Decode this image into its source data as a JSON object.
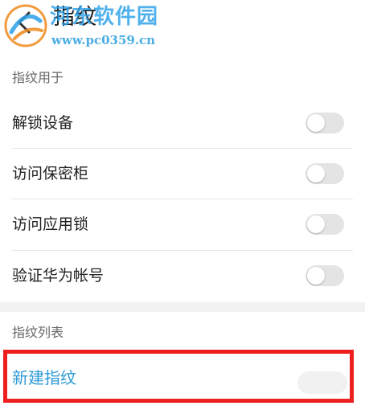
{
  "header": {
    "title": "指纹"
  },
  "watermark": {
    "site_name": "河东软件园",
    "url": "www.pc0359.cn"
  },
  "sections": {
    "usage_header": "指纹用于",
    "list_header": "指纹列表"
  },
  "settings": [
    {
      "label": "解锁设备",
      "enabled": false
    },
    {
      "label": "访问保密柜",
      "enabled": false
    },
    {
      "label": "访问应用锁",
      "enabled": false
    },
    {
      "label": "验证华为帐号",
      "enabled": false
    }
  ],
  "new_fingerprint": {
    "label": "新建指纹"
  },
  "colors": {
    "accent": "#2e9bd6",
    "highlight": "#ee1f1f",
    "toggle_off": "#e4e4e4",
    "watermark": "#2aa0e8"
  }
}
